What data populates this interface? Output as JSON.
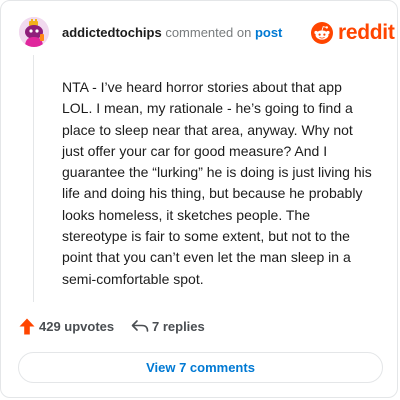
{
  "comment": {
    "username": "addictedtochips",
    "action_text": "commented on",
    "post_link": "post",
    "body": "NTA - I’ve heard horror stories about that app LOL. I mean, my rationale - he’s going to find a place to sleep near that area, anyway. Why not just offer your car for good measure? And I guarantee the “lurking” he is doing is just living his life and doing his thing, but because he probably looks homeless, it sketches people. The stereotype is fair to some extent, but not to the point that you can’t even let the man sleep in a semi-comfortable spot."
  },
  "brand": {
    "wordmark": "reddit",
    "color": "#ff4500",
    "icon": "reddit-snoo-icon"
  },
  "footer": {
    "upvotes_label": "429 upvotes",
    "upvote_icon": "upvote-arrow-icon",
    "upvote_color": "#ff4500",
    "replies_label": "7 replies",
    "reply_icon": "reply-icon",
    "view_comments_label": "View 7 comments",
    "link_color": "#0079d3"
  }
}
